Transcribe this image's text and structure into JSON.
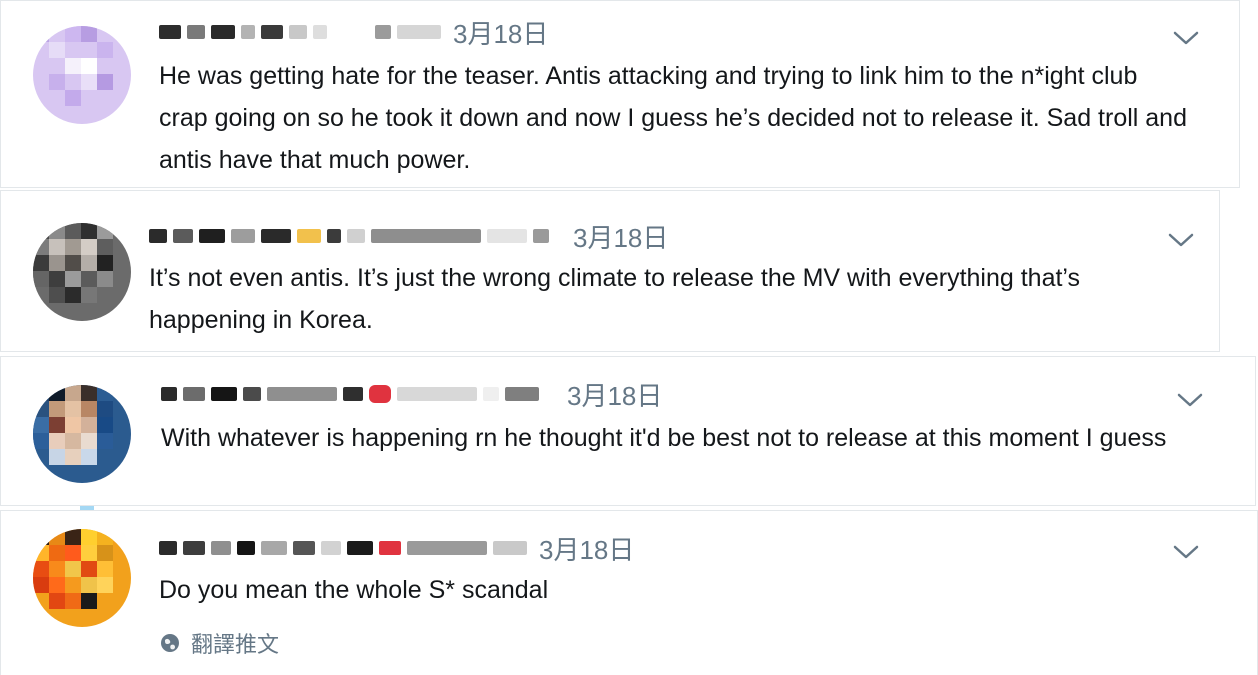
{
  "comments": [
    {
      "time": "3月18日",
      "text": "He was getting hate for the teaser. Antis attacking and trying to link him to the n*ight club crap going on so he took it down and now I guess he’s decided not to release it. Sad troll and antis have that much power.",
      "chevron_icon": "chevron-down-icon"
    },
    {
      "time": "3月18日",
      "text": "It’s not even antis. It’s just the wrong climate to release the MV with everything that’s happening in Korea.",
      "chevron_icon": "chevron-down-icon"
    },
    {
      "time": "3月18日",
      "text": "With whatever is happening rn he thought it'd be best not to release at this moment I guess",
      "chevron_icon": "chevron-down-icon"
    },
    {
      "time": "3月18日",
      "text": "Do you mean the whole S* scandal",
      "chevron_icon": "chevron-down-icon"
    }
  ],
  "translate": {
    "label": "翻譯推文",
    "icon": "globe-icon"
  },
  "colors": {
    "text": "#14171a",
    "secondary": "#657786",
    "line": "#9fd6f3",
    "border": "#e3e7ea"
  }
}
